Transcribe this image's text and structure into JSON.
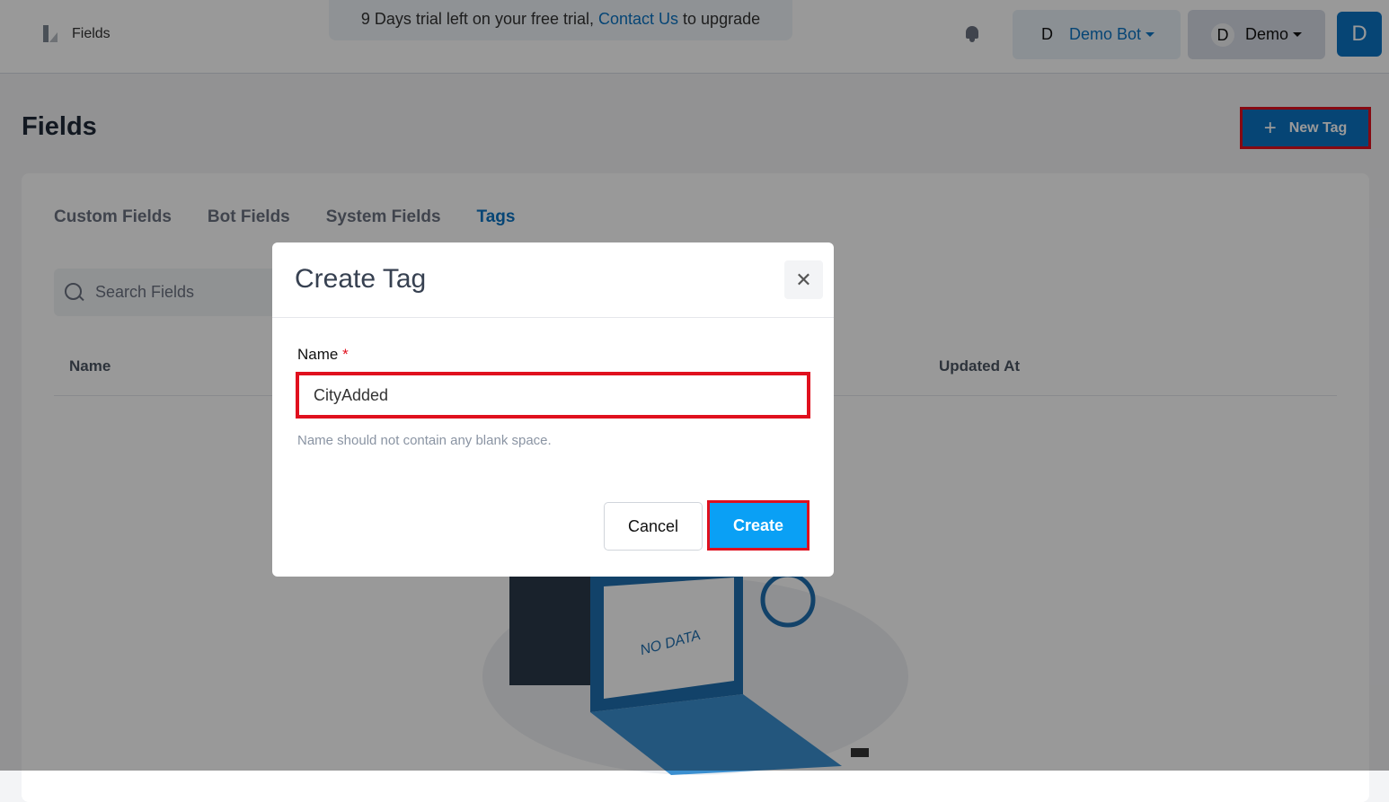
{
  "topbar": {
    "breadcrumb": "Fields",
    "trial_prefix": "9 Days trial left on your free trial, ",
    "trial_link": "Contact Us",
    "trial_suffix": " to upgrade",
    "bot_avatar": "D",
    "bot_name": "Demo Bot",
    "user_avatar": "D",
    "user_name": "Demo",
    "profile_initial": "D"
  },
  "page": {
    "title": "Fields",
    "new_tag_label": "New Tag"
  },
  "tabs": [
    {
      "label": "Custom Fields"
    },
    {
      "label": "Bot Fields"
    },
    {
      "label": "System Fields"
    },
    {
      "label": "Tags",
      "active": true
    }
  ],
  "search": {
    "placeholder": "Search Fields"
  },
  "table": {
    "columns": [
      "Name",
      "Updated At"
    ]
  },
  "empty_state": {
    "illustration_text": "NO DATA"
  },
  "modal": {
    "title": "Create Tag",
    "field_label": "Name",
    "required_mark": "*",
    "field_value": "CityAdded",
    "hint": "Name should not contain any blank space.",
    "cancel_label": "Cancel",
    "create_label": "Create"
  },
  "colors": {
    "accent": "#0b74c4",
    "create_button": "#0aa0f5",
    "highlight": "#e0101e"
  }
}
